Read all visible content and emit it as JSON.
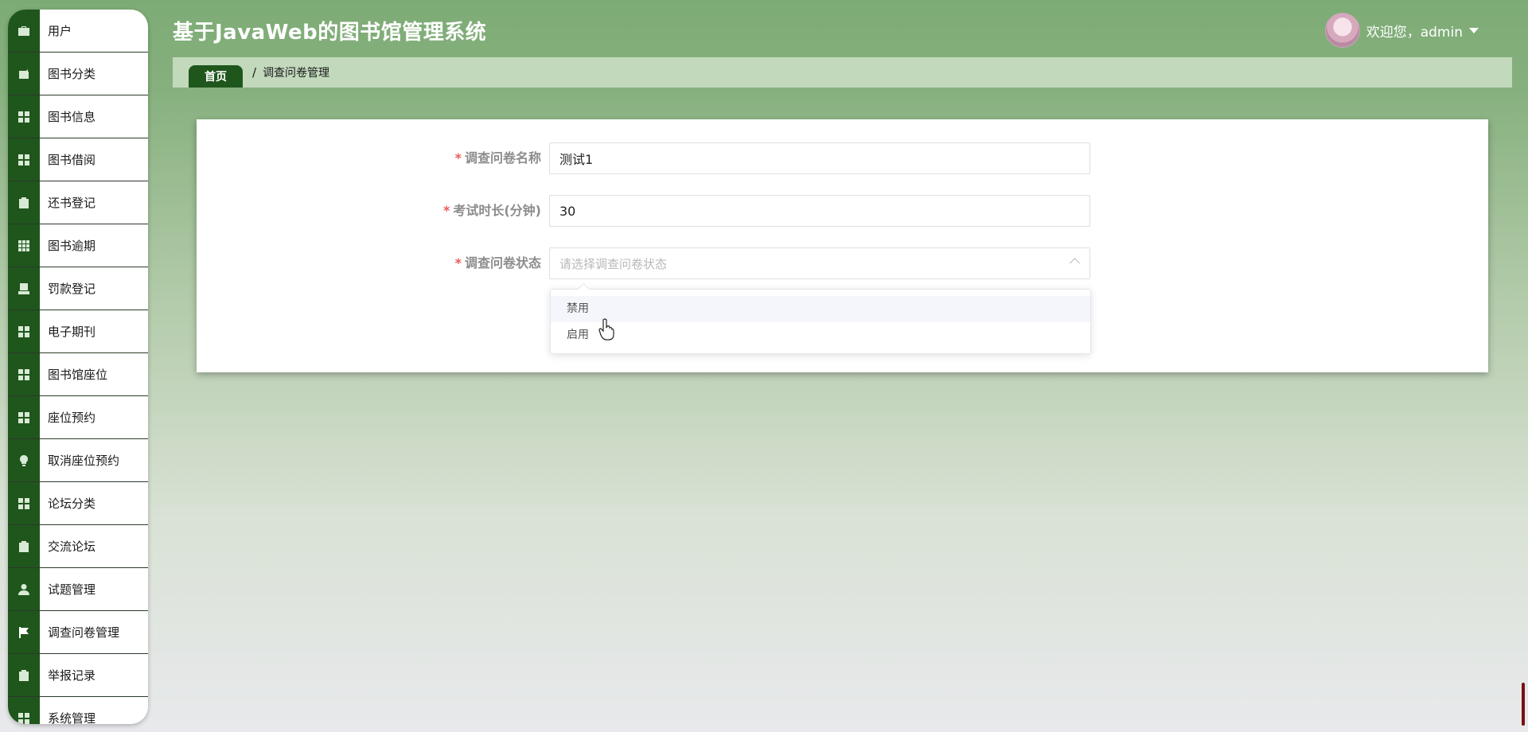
{
  "app": {
    "title": "基于JavaWeb的图书馆管理系统",
    "welcome": "欢迎您，admin"
  },
  "sidebar": {
    "items": [
      {
        "label": "用户",
        "icon": "briefcase-icon"
      },
      {
        "label": "图书分类",
        "icon": "wallet-icon"
      },
      {
        "label": "图书信息",
        "icon": "grid-icon"
      },
      {
        "label": "图书借阅",
        "icon": "grid-icon"
      },
      {
        "label": "还书登记",
        "icon": "clipboard-icon"
      },
      {
        "label": "图书逾期",
        "icon": "grid-dense-icon"
      },
      {
        "label": "罚款登记",
        "icon": "tray-icon"
      },
      {
        "label": "电子期刊",
        "icon": "grid-icon"
      },
      {
        "label": "图书馆座位",
        "icon": "grid-icon"
      },
      {
        "label": "座位预约",
        "icon": "grid-icon"
      },
      {
        "label": "取消座位预约",
        "icon": "lightbulb-icon"
      },
      {
        "label": "论坛分类",
        "icon": "grid-icon"
      },
      {
        "label": "交流论坛",
        "icon": "clipboard-x-icon"
      },
      {
        "label": "试题管理",
        "icon": "person-icon"
      },
      {
        "label": "调查问卷管理",
        "icon": "flag-icon"
      },
      {
        "label": "举报记录",
        "icon": "clipboard-check-icon"
      },
      {
        "label": "系统管理",
        "icon": "grid-icon"
      }
    ],
    "active_index": 14
  },
  "breadcrumb": {
    "home": "首页",
    "separator": "/",
    "current": "调查问卷管理"
  },
  "form": {
    "name": {
      "label": "调查问卷名称",
      "value": "测试1"
    },
    "duration": {
      "label": "考试时长(分钟)",
      "value": "30"
    },
    "status": {
      "label": "调查问卷状态",
      "placeholder": "请选择调查问卷状态"
    },
    "required_mark": "*"
  },
  "dropdown": {
    "options": [
      "禁用",
      "启用"
    ],
    "hovered_index": 0
  },
  "colors": {
    "rail": "#1f561c",
    "header_green": "#7dab75",
    "breadcrumb_bg": "#c2d9bc",
    "required": "#e85c5c"
  }
}
